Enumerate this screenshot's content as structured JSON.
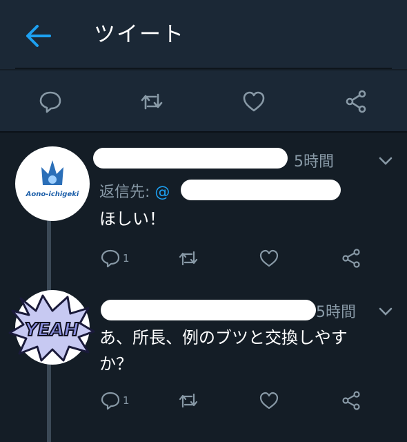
{
  "header": {
    "title": "ツイート",
    "back_icon": "arrow-left-icon",
    "accent": "#1da1f2"
  },
  "action_bar": {
    "icons": [
      "reply-icon",
      "retweet-icon",
      "like-icon",
      "share-icon"
    ]
  },
  "tweets": [
    {
      "avatar_text": "Aono-ichigeki",
      "time": "5時間",
      "reply_prefix": "返信先:",
      "reply_handle": "@",
      "text": "ほしい！",
      "reply_count": "1"
    },
    {
      "avatar_text": "YEAH",
      "time": "5時間",
      "text_line1": "あ、所長、例のブツと交換しやす",
      "text_line2": "か？",
      "reply_count": "1"
    }
  ]
}
